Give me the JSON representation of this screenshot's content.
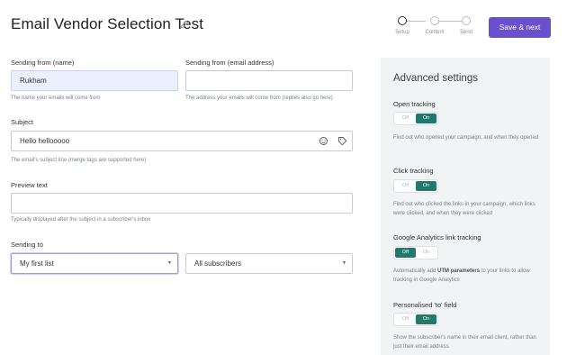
{
  "header": {
    "title": "Email Vendor Selection Test",
    "save_label": "Save & next",
    "steps": [
      {
        "label": "Setup",
        "active": true
      },
      {
        "label": "Content",
        "active": false
      },
      {
        "label": "Send",
        "active": false
      }
    ]
  },
  "form": {
    "from_name": {
      "label": "Sending from (name)",
      "value": "Rukham",
      "help": "The name your emails will come from"
    },
    "from_email": {
      "label": "Sending from (email address)",
      "value": "",
      "help": "The address your emails will come from (replies also go here)"
    },
    "subject": {
      "label": "Subject",
      "value": "Hello hellooooo",
      "help": "The email's subject line (merge tags are supported here)"
    },
    "preview": {
      "label": "Preview text",
      "value": "",
      "help": "Typically displayed after the subject in a subscriber's inbox"
    },
    "sending_to": {
      "label": "Sending to",
      "list_value": "My first list",
      "segment_value": "All subscribers"
    }
  },
  "advanced": {
    "title": "Advanced settings",
    "settings": [
      {
        "label": "Open tracking",
        "off": "Off",
        "on": "On",
        "enabled": true,
        "desc": "Find out who opened your campaign, and when they opened"
      },
      {
        "label": "Click tracking",
        "off": "Off",
        "on": "On",
        "enabled": true,
        "desc": "Find out who clicked the links in your campaign, which links were clicked, and when they were clicked"
      },
      {
        "label": "Google Analytics link tracking",
        "off": "Off",
        "on": "On",
        "enabled": false,
        "desc_pre": "Automatically add ",
        "desc_bold": "UTM parameters",
        "desc_post": " to your links to allow tracking in Google Analytics"
      },
      {
        "label": "Personalised 'to' field",
        "off": "Off",
        "on": "On",
        "enabled": true,
        "desc": "Show the subscriber's name in their email client, rather than just their email address"
      }
    ]
  },
  "colors": {
    "accent": "#6a4fcf",
    "toggle_on": "#1f7a6d",
    "panel_bg": "#f1f3f4"
  },
  "icons": [
    "pencil-icon",
    "emoji-icon",
    "tag-icon",
    "chevron-down-icon"
  ]
}
